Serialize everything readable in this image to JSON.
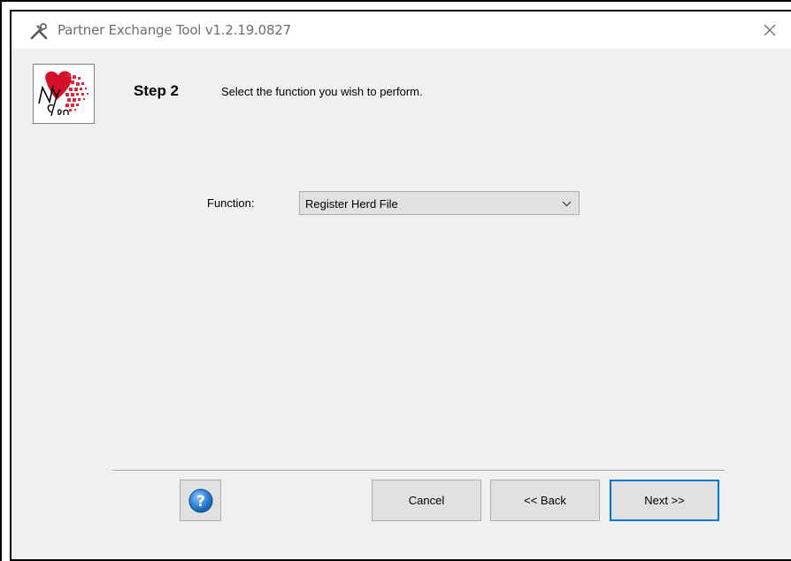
{
  "window": {
    "title": "Partner Exchange Tool v1.2.19.0827"
  },
  "header": {
    "step_label": "Step 2",
    "step_description": "Select the function you wish to perform."
  },
  "form": {
    "function_label": "Function:",
    "function_value": "Register Herd File"
  },
  "buttons": {
    "cancel_label": "Cancel",
    "back_label": "<< Back",
    "next_label": "Next >>"
  },
  "colors": {
    "accent": "#0078d7",
    "background": "#f0f0f0",
    "button": "#e1e1e1"
  },
  "icons": {
    "app": "tools-icon",
    "close": "close-icon",
    "help": "help-icon",
    "dropdown": "chevron-down-icon",
    "logo": "ny-gen-logo"
  }
}
